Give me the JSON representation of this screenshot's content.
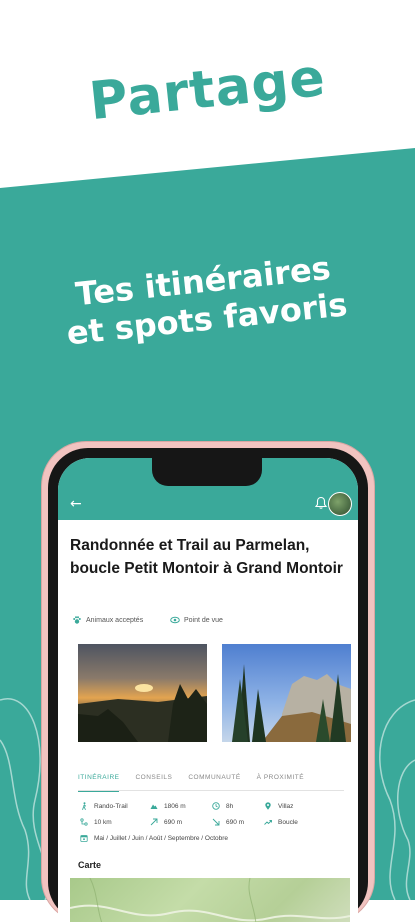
{
  "colors": {
    "teal": "#3aa99a",
    "phone_frame": "#f1c3c0"
  },
  "headline": "Partage",
  "tagline_line1": "Tes itinéraires",
  "tagline_line2": "et spots favoris",
  "app": {
    "route_title": "Randonnée et Trail au Parmelan, boucle Petit Montoir à Grand Montoir",
    "attributes": [
      {
        "label": "Animaux acceptés",
        "icon": "paw-icon"
      },
      {
        "label": "Point de vue",
        "icon": "eye-icon"
      }
    ],
    "tabs": [
      "ITINÉRAIRE",
      "CONSEILS",
      "COMMUNAUTÉ",
      "À PROXIMITÉ"
    ],
    "info": {
      "activity": "Rando-Trail",
      "altitude": "1806 m",
      "duration": "8h",
      "start": "Villaz",
      "distance": "10 km",
      "ascent": "690 m",
      "descent": "690 m",
      "type": "Boucle",
      "months": "Mai / Juillet / Juin / Août / Septembre / Octobre"
    },
    "map_label": "Carte"
  }
}
